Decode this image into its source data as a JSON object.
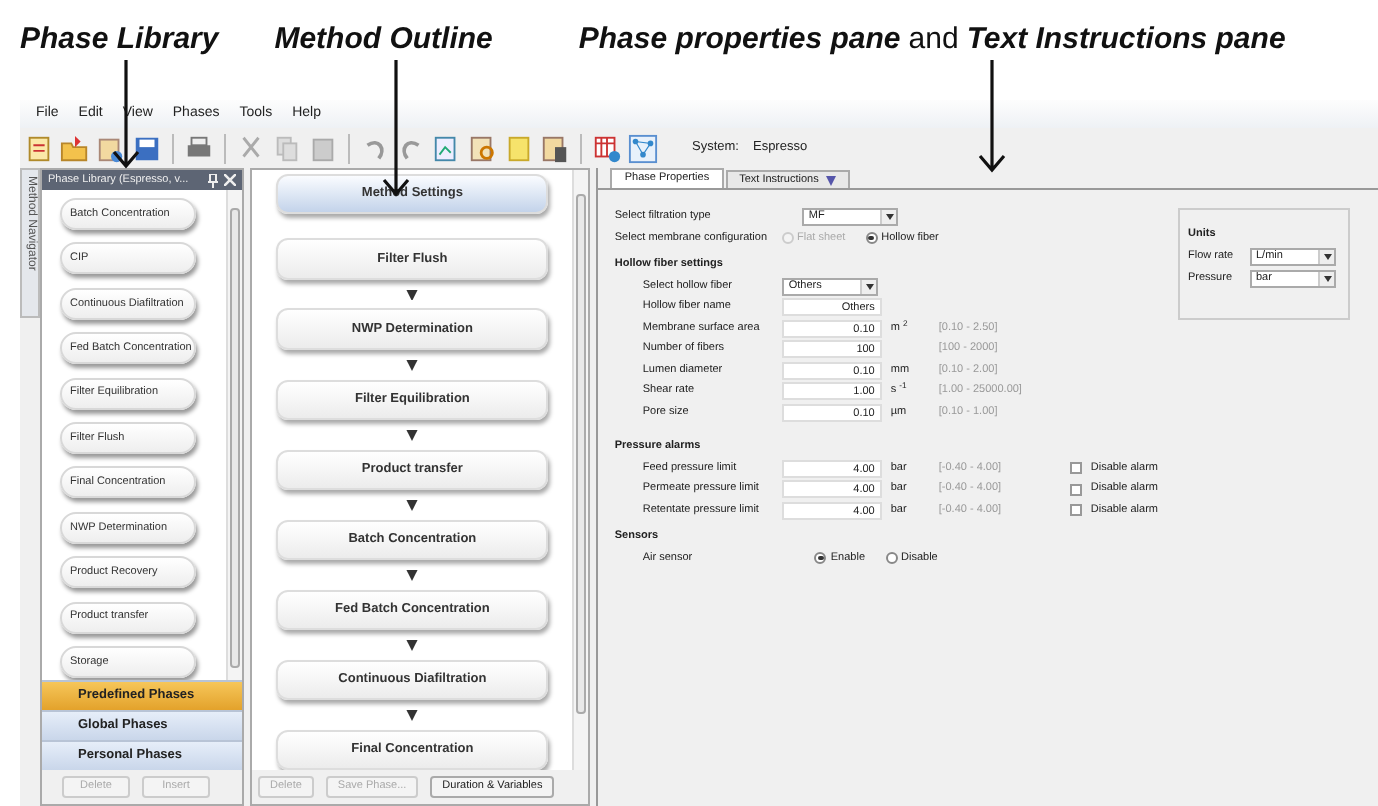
{
  "annotations": [
    {
      "segments": [
        {
          "text": "Phase Library",
          "emphasis": true
        }
      ]
    },
    {
      "segments": [
        {
          "text": "Method Outline",
          "emphasis": true
        }
      ]
    },
    {
      "segments": [
        {
          "text": "Phase properties pane",
          "emphasis": true
        },
        {
          "text": "and",
          "emphasis": false
        },
        {
          "text": "Text Instructions pane",
          "emphasis": true
        }
      ]
    }
  ],
  "menu": [
    "File",
    "Edit",
    "View",
    "Phases",
    "Tools",
    "Help"
  ],
  "system": {
    "label": "System:",
    "value": "Espresso"
  },
  "side_tab": "Method Navigator",
  "phase_library": {
    "title": "Phase Library (Espresso, v...",
    "items": [
      "Batch Concentration",
      "CIP",
      "Continuous Diafiltration",
      "Fed Batch Concentration",
      "Filter Equilibration",
      "Filter Flush",
      "Final Concentration",
      "NWP Determination",
      "Product Recovery",
      "Product transfer",
      "Storage"
    ],
    "groups": [
      {
        "label": "Predefined Phases",
        "selected": true
      },
      {
        "label": "Global Phases",
        "selected": false
      },
      {
        "label": "Personal Phases",
        "selected": false
      }
    ],
    "buttons": [
      {
        "label": "Delete",
        "disabled": true
      },
      {
        "label": "Insert",
        "disabled": true
      }
    ]
  },
  "method_outline": {
    "items": [
      {
        "label": "Method Settings",
        "selected": true
      },
      {
        "label": "Filter Flush",
        "selected": false
      },
      {
        "label": "NWP Determination",
        "selected": false
      },
      {
        "label": "Filter Equilibration",
        "selected": false
      },
      {
        "label": "Product transfer",
        "selected": false
      },
      {
        "label": "Batch Concentration",
        "selected": false
      },
      {
        "label": "Fed Batch Concentration",
        "selected": false
      },
      {
        "label": "Continuous Diafiltration",
        "selected": false
      },
      {
        "label": "Final Concentration",
        "selected": false
      }
    ],
    "buttons": [
      {
        "label": "Delete",
        "disabled": true
      },
      {
        "label": "Save Phase...",
        "disabled": true
      },
      {
        "label": "Duration & Variables",
        "disabled": false
      }
    ]
  },
  "properties": {
    "tabs": [
      {
        "label": "Phase Properties",
        "selected": true
      },
      {
        "label": "Text Instructions",
        "selected": false
      }
    ],
    "filtration_type": {
      "label": "Select filtration type",
      "value": "MF"
    },
    "membrane_configuration": {
      "label": "Select membrane configuration",
      "options": [
        {
          "label": "Flat sheet",
          "selected": false,
          "disabled": true
        },
        {
          "label": "Hollow fiber",
          "selected": true,
          "disabled": false
        }
      ]
    },
    "hollow_fiber": {
      "title": "Hollow fiber settings",
      "select": {
        "label": "Select hollow fiber",
        "value": "Others"
      },
      "fields": [
        {
          "label": "Hollow fiber name",
          "value": "Others"
        },
        {
          "label": "Membrane surface area",
          "value": "0.10",
          "unit": "m $^{2}$",
          "range": "[0.10 - 2.50]"
        },
        {
          "label": "Number of fibers",
          "value": "100",
          "range": "[100 - 2000]"
        },
        {
          "label": "Lumen diameter",
          "value": "0.10",
          "unit": "mm",
          "range": "[0.10 - 2.00]"
        },
        {
          "label": "Shear rate",
          "value": "1.00",
          "unit": "s $^{-1}$",
          "range": "[1.00 - 25000.00]"
        },
        {
          "label": "Pore size",
          "value": "0.10",
          "unit": "µm",
          "range": "[0.10 - 1.00]"
        }
      ]
    },
    "pressure_alarms": {
      "title": "Pressure alarms",
      "rows": [
        {
          "label": "Feed pressure limit",
          "value": "4.00",
          "unit": "bar",
          "range": "[-0.40 - 4.00]",
          "check_label": "Disable alarm",
          "checked": false
        },
        {
          "label": "Permeate pressure limit",
          "value": "4.00",
          "unit": "bar",
          "range": "[-0.40 - 4.00]",
          "check_label": "Disable alarm",
          "checked": false
        },
        {
          "label": "Retentate pressure limit",
          "value": "4.00",
          "unit": "bar",
          "range": "[-0.40 - 4.00]",
          "check_label": "Disable alarm",
          "checked": false
        }
      ]
    },
    "sensors": {
      "title": "Sensors",
      "label": "Air sensor",
      "options": [
        {
          "label": "Enable",
          "selected": true
        },
        {
          "label": "Disable",
          "selected": false
        }
      ]
    },
    "units": {
      "title": "Units",
      "rows": [
        {
          "label": "Flow rate",
          "value": "L/min"
        },
        {
          "label": "Pressure",
          "value": "bar"
        }
      ]
    }
  }
}
